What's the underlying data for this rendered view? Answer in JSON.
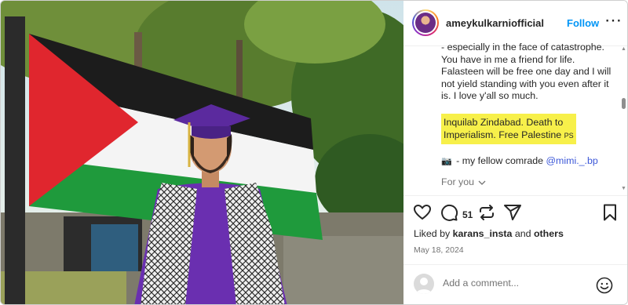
{
  "post": {
    "username": "ameykulkarniofficial",
    "follow_label": "Follow",
    "more_label": "⋯"
  },
  "caption": {
    "para1": "- especially in the face of catastrophe. You have in me a friend for life. Falasteen will be free one day and I will not yield standing with you even after it is. I love y'all so much.",
    "highlight_line1": "Inquilab Zindabad. Death to",
    "highlight_line2": "Imperialism. Free Palestine",
    "highlight_ps": "PS",
    "para3_prefix": "- my fellow comrade",
    "mention": "@mimi._.bp",
    "for_you": "For you"
  },
  "actions": {
    "comment_count": "51"
  },
  "likes": {
    "prefix": "Liked by",
    "user": "karans_insta",
    "and": "and",
    "others": "others"
  },
  "date": "May 18, 2024",
  "comment": {
    "placeholder": "Add a comment..."
  },
  "colors": {
    "follow": "#0095f6",
    "highlight": "#f7f04a",
    "mention": "#3b57d8",
    "muted": "#737373",
    "flag_black": "#1c1c1c",
    "flag_white": "#f4f4f4",
    "flag_green": "#1f9a3c",
    "flag_red": "#e0262e",
    "gown_purple": "#6a2fb0"
  }
}
